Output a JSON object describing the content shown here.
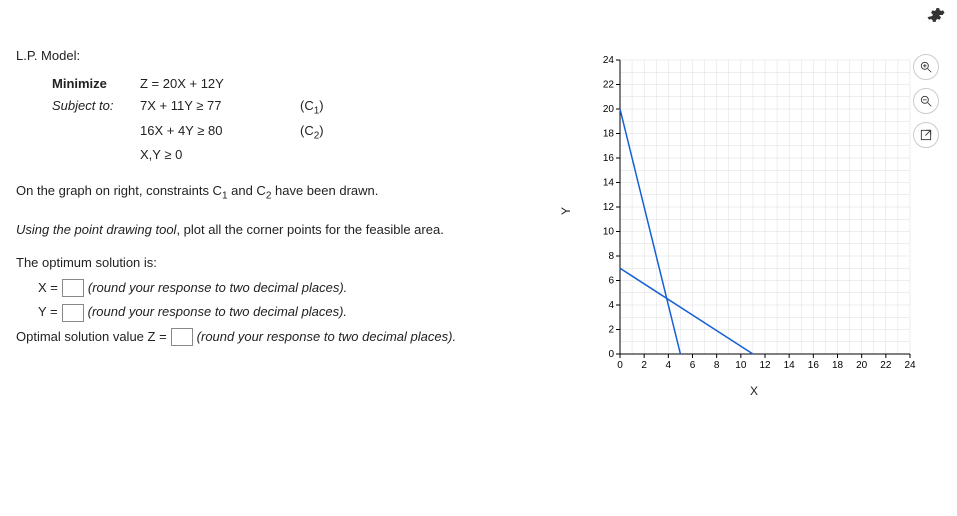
{
  "lp_title": "L.P. Model:",
  "model": {
    "minimize_label": "Minimize",
    "objective": "Z = 20X + 12Y",
    "subject_label": "Subject to:",
    "c1_expr": "7X + 11Y ≥ 77",
    "c1_tag": "(C",
    "c1_sub": "1",
    "c1_close": ")",
    "c2_expr": "16X + 4Y ≥ 80",
    "c2_tag": "(C",
    "c2_sub": "2",
    "c2_close": ")",
    "nonneg": "X,Y ≥ 0"
  },
  "instr1a": "On the graph on right, constraints C",
  "instr1b": " and C",
  "instr1c": " have been drawn.",
  "sub1": "1",
  "sub2": "2",
  "instr2a": "Using the point drawing tool",
  "instr2b": ", plot all the corner points for the feasible area.",
  "opt_title": "The optimum solution is:",
  "x_label": "X =",
  "y_label": "Y =",
  "z_label": "Optimal solution value Z  =",
  "hint_two": "(round your response to two decimal places).",
  "axes": {
    "xlabel": "X",
    "ylabel": "Y"
  },
  "ticks_y": [
    "24",
    "22",
    "20",
    "18",
    "16",
    "14",
    "12",
    "10",
    "8",
    "6",
    "4",
    "2",
    "0"
  ],
  "ticks_x": [
    "0",
    "2",
    "4",
    "6",
    "8",
    "10",
    "12",
    "14",
    "16",
    "18",
    "20",
    "22",
    "24"
  ],
  "chart_data": {
    "type": "line",
    "xlabel": "X",
    "ylabel": "Y",
    "xlim": [
      0,
      24
    ],
    "ylim": [
      0,
      24
    ],
    "grid": true,
    "series": [
      {
        "name": "C1",
        "points": [
          [
            0,
            7
          ],
          [
            11,
            0
          ]
        ]
      },
      {
        "name": "C2",
        "points": [
          [
            0,
            20
          ],
          [
            5,
            0
          ]
        ]
      }
    ]
  }
}
